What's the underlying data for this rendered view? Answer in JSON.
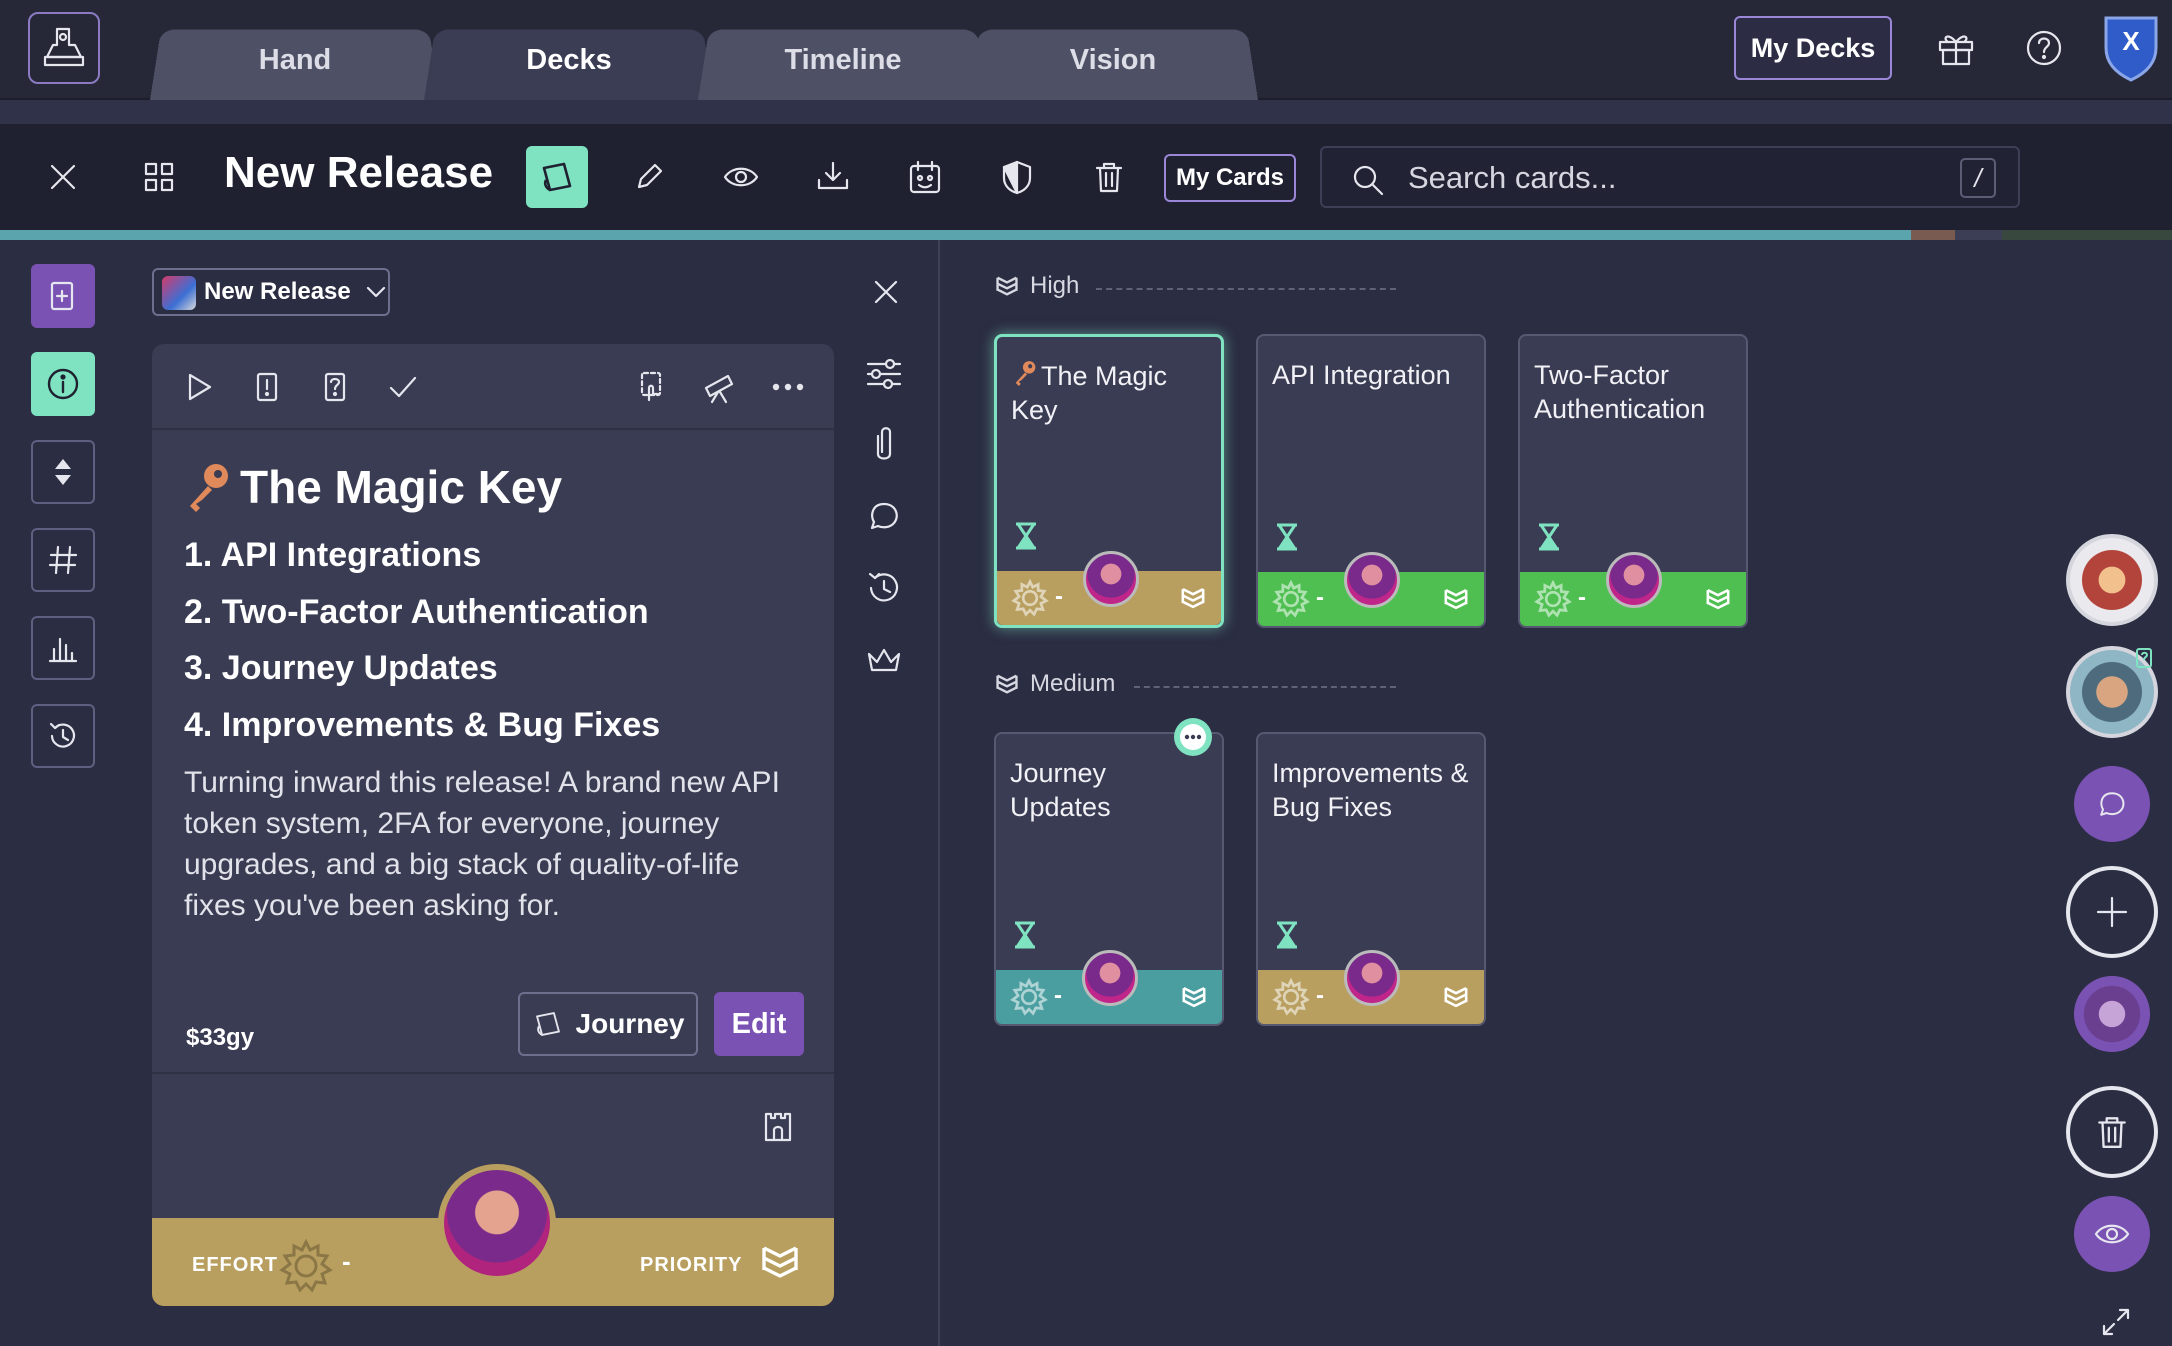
{
  "nav": {
    "tabs": [
      {
        "label": "Hand",
        "active": false
      },
      {
        "label": "Decks",
        "active": true
      },
      {
        "label": "Timeline",
        "active": false
      },
      {
        "label": "Vision",
        "active": false
      }
    ],
    "my_decks_label": "My Decks",
    "profile_badge_letter": "X"
  },
  "toolbar": {
    "deck_title": "New Release",
    "my_cards_label": "My Cards",
    "search_placeholder": "Search cards...",
    "search_shortcut": "/"
  },
  "progress": {
    "fraction": 0.9,
    "marker_fraction": 0.9
  },
  "detail": {
    "deck_selector_label": "New Release",
    "card_title": "The Magic Key",
    "features": [
      "1. API Integrations",
      "2. Two-Factor Authentication",
      "3. Journey Updates",
      "4. Improvements & Bug Fixes"
    ],
    "description": "Turning inward this release! A brand new API token system, 2FA for everyone, journey upgrades, and a big stack of quality-of-life fixes you've been asking for.",
    "cost": "$33gy",
    "journey_label": "Journey",
    "edit_label": "Edit",
    "effort_label": "EFFORT",
    "effort_value": "-",
    "priority_label": "PRIORITY"
  },
  "board": {
    "lanes": [
      {
        "label": "High",
        "cards": [
          {
            "name": "The Magic Key",
            "effort": "-",
            "foot_color": "#b89f5f",
            "selected": true,
            "has_key": true
          },
          {
            "name": "API Integration",
            "effort": "-",
            "foot_color": "#4fbf52",
            "selected": false
          },
          {
            "name": "Two-Factor Authentication",
            "effort": "-",
            "foot_color": "#4fbf52",
            "selected": false
          }
        ]
      },
      {
        "label": "Medium",
        "cards": [
          {
            "name": "Journey Updates",
            "effort": "-",
            "foot_color": "#4b9ea0",
            "selected": false,
            "has_comment": true
          },
          {
            "name": "Improvements & Bug Fixes",
            "effort": "-",
            "foot_color": "#b89f5f",
            "selected": false
          }
        ]
      }
    ]
  },
  "colors": {
    "accent_mint": "#7fe3c2",
    "accent_purple": "#7a52b3",
    "gold": "#b89f5f",
    "green": "#4fbf52",
    "teal": "#4b9ea0"
  }
}
